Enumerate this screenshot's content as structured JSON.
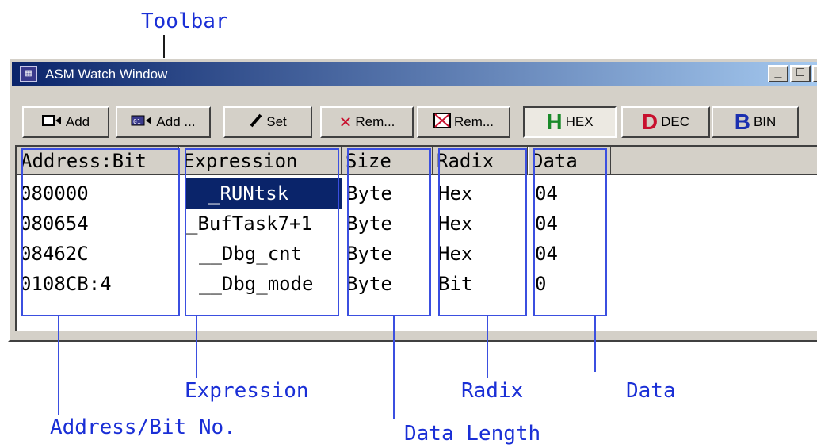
{
  "callouts": {
    "toolbar": "Toolbar",
    "address": "Address/Bit No.",
    "expression": "Expression",
    "data_length": "Data Length",
    "radix": "Radix",
    "data": "Data"
  },
  "window": {
    "title": "ASM Watch Window",
    "minimize_glyph": "_",
    "maximize_glyph": "□",
    "close_glyph": "✕"
  },
  "toolbar": {
    "buttons": [
      {
        "label": "Add",
        "icon": "add-watch-icon"
      },
      {
        "label": "Add ...",
        "icon": "add-bit-icon"
      },
      {
        "label": "Set",
        "icon": "pencil-icon"
      },
      {
        "label": "Rem...",
        "icon": "remove-x-icon"
      },
      {
        "label": "Rem...",
        "icon": "remove-all-icon"
      },
      {
        "label": "HEX",
        "letter": "H",
        "color": "#1a8a2a",
        "selected": true
      },
      {
        "label": "DEC",
        "letter": "D",
        "color": "#c8102e"
      },
      {
        "label": "BIN",
        "letter": "B",
        "color": "#1a2fb0"
      }
    ]
  },
  "table": {
    "headers": [
      "Address:Bit",
      "Expression",
      "Size",
      "Radix",
      "Data"
    ],
    "rows": [
      {
        "address": "080000",
        "expression": "_RUNtsk",
        "size": "Byte",
        "radix": "Hex",
        "data": "04",
        "selected": true
      },
      {
        "address": "080654",
        "expression": "_BufTask7+1",
        "size": "Byte",
        "radix": "Hex",
        "data": "04"
      },
      {
        "address": "08462C",
        "expression": "__Dbg_cnt",
        "size": "Byte",
        "radix": "Hex",
        "data": "04"
      },
      {
        "address": "0108CB:4",
        "expression": "__Dbg_mode",
        "size": "Byte",
        "radix": "Bit",
        "data": "0"
      }
    ]
  },
  "annotation_color": "#3b4fe0"
}
